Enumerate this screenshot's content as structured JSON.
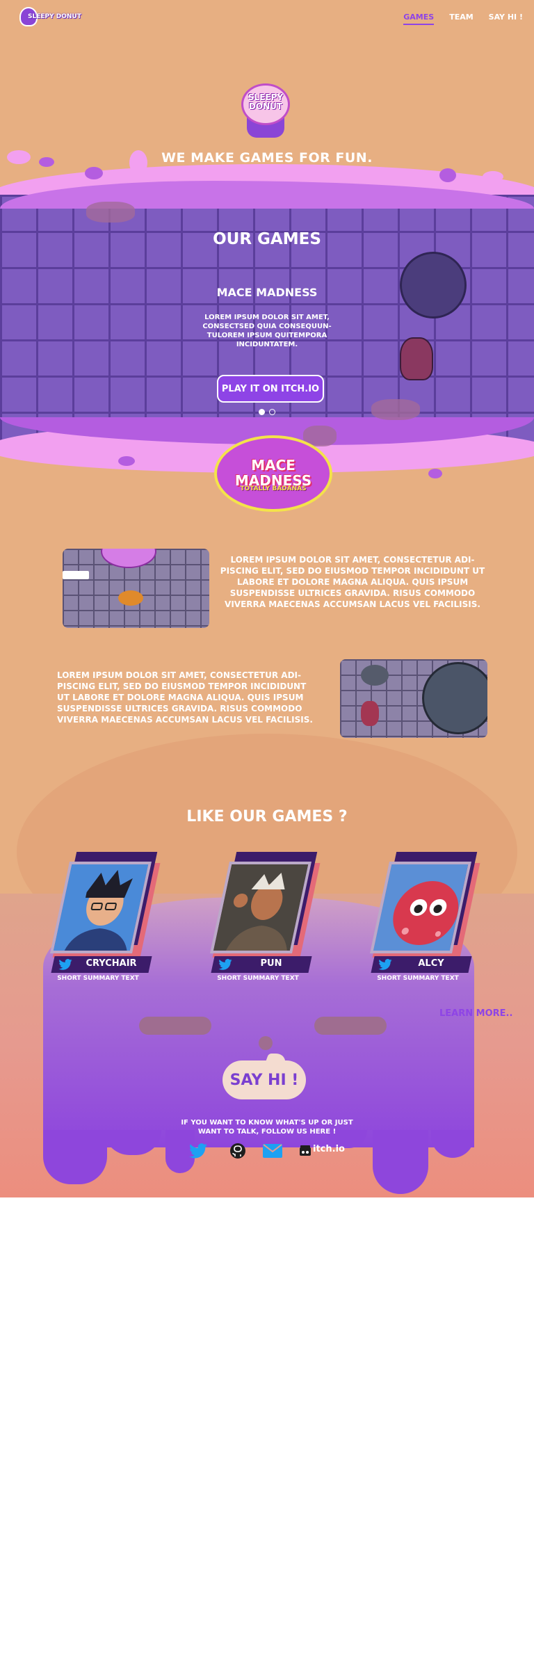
{
  "nav": {
    "logo_text": "SLEEPY DONUT",
    "links": [
      {
        "label": "GAMES"
      },
      {
        "label": "TEAM"
      },
      {
        "label": "SAY HI !"
      }
    ]
  },
  "hero": {
    "logo_text_line1": "SLEEPY",
    "logo_text_line2": "DONUT",
    "tagline": "WE MAKE GAMES FOR FUN."
  },
  "games": {
    "title": "OUR GAMES",
    "carousel": {
      "game_name": "MACE MADNESS",
      "description": "LOREM IPSUM DOLOR SIT AMET, CONSECTSED QUIA CONSEQUUN- TULOREM IPSUM QUITEMPORA INCIDUNTATEM.",
      "play_button": "PLAY IT ON ITCH.IO",
      "slide_count": 2,
      "active_slide": 1
    },
    "game_logo_title": "MACE MADNESS",
    "game_logo_subtitle": "TOTALLY BADANAS"
  },
  "features": [
    {
      "text": "LOREM IPSUM DOLOR SIT AMET, CONSECTETUR ADI- PISCING ELIT, SED DO EIUSMOD TEMPOR INCIDIDUNT UT LABORE ET DOLORE MAGNA ALIQUA. QUIS IPSUM SUSPENDISSE ULTRICES GRAVIDA. RISUS COMMODO VIVERRA MAECENAS ACCUMSAN LACUS VEL FACILISIS."
    },
    {
      "text": "LOREM IPSUM DOLOR SIT AMET, CONSECTETUR ADI- PISCING ELIT, SED DO EIUSMOD TEMPOR INCIDIDUNT UT LABORE ET DOLORE MAGNA ALIQUA. QUIS IPSUM SUSPENDISSE ULTRICES GRAVIDA. RISUS COMMODO VIVERRA MAECENAS ACCUMSAN LACUS VEL FACILISIS."
    }
  ],
  "team": {
    "title": "LIKE OUR GAMES ?",
    "members": [
      {
        "name": "CRYCHAIR",
        "summary": "SHORT SUMMARY TEXT",
        "icon": "twitter-icon"
      },
      {
        "name": "PUN",
        "summary": "SHORT SUMMARY TEXT",
        "icon": "twitter-icon"
      },
      {
        "name": "ALCY",
        "summary": "SHORT SUMMARY TEXT",
        "icon": "twitter-icon"
      }
    ],
    "learn_more": "LEARN MORE.."
  },
  "contact": {
    "say_hi": "SAY HI !",
    "follow_text": "IF YOU WANT TO KNOW WHAT'S UP OR JUST WANT TO TALK, FOLLOW US HERE !",
    "socials": [
      {
        "icon": "twitter-icon"
      },
      {
        "icon": "github-icon"
      },
      {
        "icon": "mail-icon"
      },
      {
        "icon": "itchio-icon",
        "label": "itch.io"
      }
    ]
  },
  "colors": {
    "page_background": "#e7af82",
    "accent_purple": "#8e44e6",
    "slime_pink": "#f2a0f0",
    "grid_purple": "#7e5cc0",
    "twitter_blue": "#1da1f2"
  }
}
